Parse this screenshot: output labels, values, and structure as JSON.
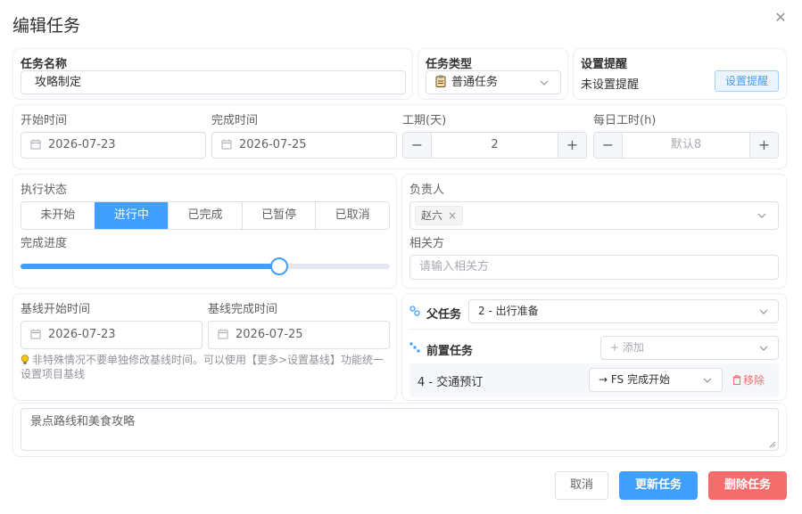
{
  "dialog": {
    "title": "编辑任务"
  },
  "basic": {
    "task_name_label": "任务名称",
    "task_name_value": "攻略制定",
    "task_type_label": "任务类型",
    "task_type_value": "普通任务",
    "reminder_label": "设置提醒",
    "reminder_status": "未设置提醒",
    "reminder_button": "设置提醒"
  },
  "schedule": {
    "start_label": "开始时间",
    "start_value": "2026-07-23",
    "end_label": "完成时间",
    "end_value": "2026-07-25",
    "duration_label": "工期(天)",
    "duration_value": "2",
    "daily_hours_label": "每日工时(h)",
    "daily_hours_placeholder": "默认8",
    "minus": "−",
    "plus": "+"
  },
  "status": {
    "label": "执行状态",
    "options": [
      "未开始",
      "进行中",
      "已完成",
      "已暂停",
      "已取消"
    ],
    "selected_index": 1,
    "progress_label": "完成进度",
    "progress_fraction": 0.7
  },
  "people": {
    "owner_label": "负责人",
    "owner_tag": "赵六",
    "tag_close": "×",
    "related_label": "相关方",
    "related_placeholder": "请输入相关方"
  },
  "baseline": {
    "start_label": "基线开始时间",
    "start_value": "2026-07-23",
    "end_label": "基线完成时间",
    "end_value": "2026-07-25",
    "hint": "非特殊情况不要单独修改基线时间。可以使用【更多>设置基线】功能统一设置项目基线"
  },
  "deps": {
    "parent_label": "父任务",
    "parent_value": "2 - 出行准备",
    "pre_label": "前置任务",
    "add_placeholder": "+ 添加",
    "items": [
      {
        "name": "4 - 交通预订",
        "relation": "→ FS 完成开始",
        "remove": "移除"
      }
    ]
  },
  "description": {
    "value": "景点路线和美食攻略"
  },
  "footer": {
    "cancel": "取消",
    "update": "更新任务",
    "delete": "删除任务"
  },
  "colors": {
    "primary": "#409eff",
    "danger": "#f56c6c",
    "border": "#dcdfe6",
    "text": "#303133"
  }
}
